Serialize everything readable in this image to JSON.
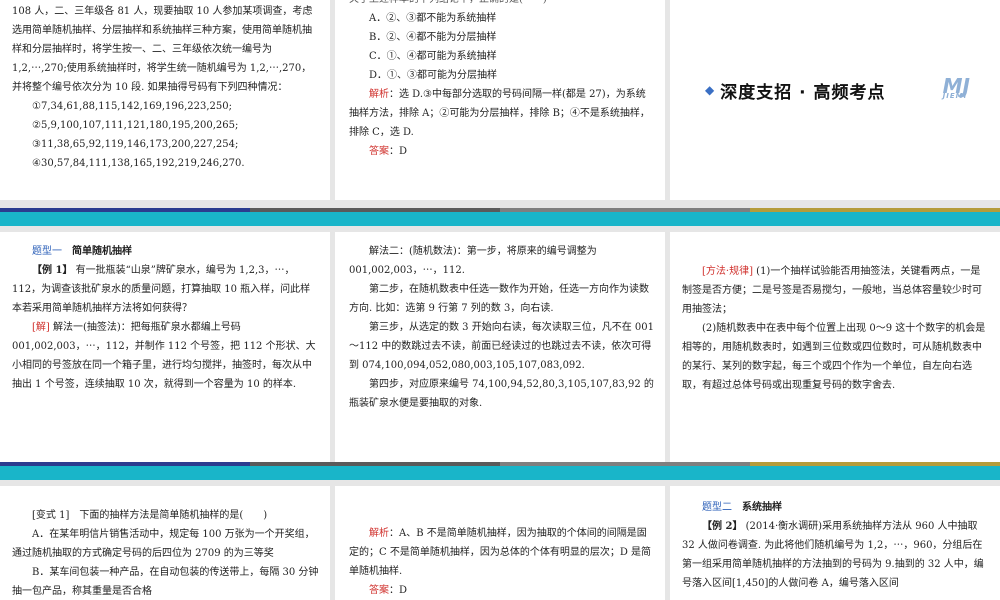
{
  "s1": {
    "lines": [
      "108 人，二、三年级各 81 人，现要抽取 10 人参加某项调查，考虑选用简单随机抽样、分层抽样和系统抽样三种方案，使用简单随机抽样和分层抽样时，将学生按一、二、三年级依次统一编号为 1,2,⋯,270;使用系统抽样时，将学生统一随机编号为 1,2,⋯,270，并将整个编号依次分为 10 段. 如果抽得号码有下列四种情况："
    ],
    "options": [
      "①7,34,61,88,115,142,169,196,223,250;",
      "②5,9,100,107,111,121,180,195,200,265;",
      "③11,38,65,92,119,146,173,200,227,254;",
      "④30,57,84,111,138,165,192,219,246,270."
    ]
  },
  "s2": {
    "top": "关于上述样本的下列结论中，正确的是(　　)",
    "choices": [
      "A．②、③都不能为系统抽样",
      "B．②、④都不能为分层抽样",
      "C．①、④都可能为系统抽样",
      "D．①、③都可能为分层抽样"
    ],
    "analysis_label": "解析",
    "analysis": "：选 D.③中每部分选取的号码间隔一样(都是 27)，为系统抽样方法，排除 A；②可能为分层抽样，排除 B；④不是系统抽样，排除 C，选 D.",
    "answer_label": "答案",
    "answer": "：D"
  },
  "s3": {
    "banner": "深度支招 · 高频考点",
    "logo": "MJ",
    "logo_sub": "JIEMI"
  },
  "s4": {
    "type_label": "题型一",
    "type_title": "简单随机抽样",
    "example_label": "【例 1】",
    "example": "有一批瓶装“山泉”牌矿泉水，编号为 1,2,3，⋯，112，为调查该批矿泉水的质量问题，打算抽取 10 瓶入样，问此样本若采用简单随机抽样方法将如何获得？",
    "sol_label": "[解]",
    "sol": "解法一(抽签法)：把每瓶矿泉水都编上号码 001,002,003，⋯，112，并制作 112 个号签，把 112 个形状、大小相同的号签放在同一个箱子里，进行均匀搅拌，抽签时，每次从中抽出 1 个号签，连续抽取 10 次，就得到一个容量为 10 的样本."
  },
  "s5": {
    "paras": [
      "解法二：(随机数法)：第一步，将原来的编号调整为 001,002,003，⋯，112.",
      "第二步，在随机数表中任选一数作为开始，任选一方向作为读数方向. 比如：选第 9 行第 7 列的数 3，向右读.",
      "第三步，从选定的数 3 开始向右读，每次读取三位，凡不在 001～112 中的数跳过去不读，前面已经读过的也跳过去不读，依次可得到 074,100,094,052,080,003,105,107,083,092.",
      "第四步，对应原来编号 74,100,94,52,80,3,105,107,83,92 的瓶装矿泉水便是要抽取的对象."
    ]
  },
  "s6": {
    "label": "[方法·规律]",
    "p1": "(1)一个抽样试验能否用抽签法，关键看两点，一是制签是否方便；二是号签是否易搅匀，一般地，当总体容量较少时可用抽签法；",
    "p2": "(2)随机数表中在表中每个位置上出现 0～9 这十个数字的机会是相等的，用随机数表时，如遇到三位数或四位数时，可从随机数表中的某行、某列的数字起，每三个或四个作为一个单位，自左向右选取，有超过总体号码或出现重复号码的数字舍去."
  },
  "s7": {
    "label": "[变式 1]",
    "q": "下面的抽样方法是简单随机抽样的是(　　)",
    "a": "A．在某年明信片销售活动中，规定每 100 万张为一个开奖组，通过随机抽取的方式确定号码的后四位为 2709 的为三等奖",
    "b": "B．某车间包装一种产品，在自动包装的传送带上，每隔 30 分钟抽一包产品，称其重量是否合格"
  },
  "s8": {
    "analysis_label": "解析",
    "analysis": "：A、B 不是简单随机抽样，因为抽取的个体间的间隔是固定的；C 不是简单随机抽样，因为总体的个体有明显的层次；D 是简单随机抽样.",
    "answer_label": "答案",
    "answer": "：D"
  },
  "s9": {
    "type_label": "题型二",
    "type_title": "系统抽样",
    "example_label": "【例 2】",
    "example": "(2014·衡水调研)采用系统抽样方法从 960 人中抽取 32 人做问卷调查. 为此将他们随机编号为 1,2，⋯，960，分组后在第一组采用简单随机抽样的方法抽到的号码为 9.抽到的 32 人中，编号落入区间[1,450]的人做问卷 A，编号落入区间"
  }
}
